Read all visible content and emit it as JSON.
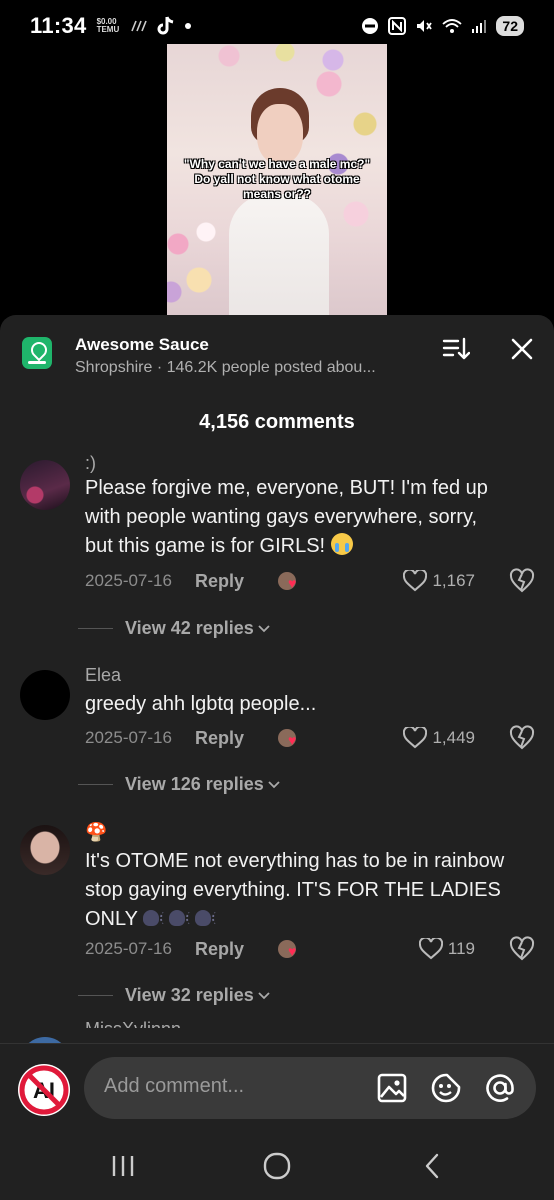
{
  "status": {
    "time": "11:34",
    "temu_line1": "$0.00",
    "temu_line2": "TEMU",
    "battery": "72"
  },
  "video": {
    "caption": "\"Why can't we have a male mc?\" Do yall not know what otome means or??"
  },
  "anchor": {
    "title": "Awesome Sauce",
    "subtitle": "Shropshire · 146.2K people posted abou..."
  },
  "comments_header": "4,156 comments",
  "comments": [
    {
      "user": ":)",
      "text": "Please forgive me, everyone, BUT! I'm fed up with people wanting gays everywhere, sorry, but this game is for GIRLS!",
      "date": "2025-07-16",
      "reply": "Reply",
      "likes": "1,167",
      "view_replies": "View 42 replies"
    },
    {
      "user": "Elea",
      "text": "greedy ahh lgbtq people...",
      "date": "2025-07-16",
      "reply": "Reply",
      "likes": "1,449",
      "view_replies": "View 126 replies"
    },
    {
      "user": "🍄",
      "text": "It's OTOME not everything has to be in rainbow stop gaying everything. IT'S FOR THE LADIES ONLY",
      "date": "2025-07-16",
      "reply": "Reply",
      "likes": "119",
      "view_replies": "View 32 replies"
    }
  ],
  "partial_user": "MissXylinnn",
  "input": {
    "placeholder": "Add comment...",
    "avatar_text": "AI"
  },
  "colors": {
    "sheet_bg": "#212121",
    "input_bg": "#3a3a3a",
    "like_heart": "#ff2d55",
    "anchor_green": "#1fb56b"
  }
}
